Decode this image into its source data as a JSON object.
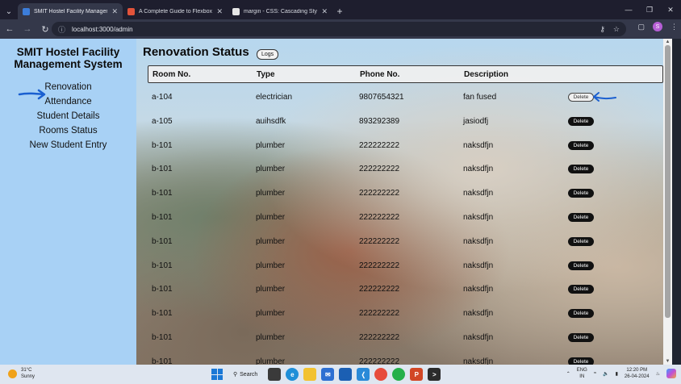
{
  "browser": {
    "tabs": [
      {
        "title": "SMIT Hostel Facility Manageme",
        "active": true,
        "favicon_color": "#3c7dd9"
      },
      {
        "title": "A Complete Guide to Flexbox |",
        "active": false,
        "favicon_color": "#e2533a"
      },
      {
        "title": "margin - CSS: Cascading Style S",
        "active": false,
        "favicon_color": "#e6e6e6"
      }
    ],
    "url": "localhost:3000/admin",
    "profile_initial": "S"
  },
  "sidebar": {
    "brand": "SMIT Hostel Facility Management System",
    "items": [
      {
        "label": "Renovation"
      },
      {
        "label": "Attendance"
      },
      {
        "label": "Student Details"
      },
      {
        "label": "Rooms Status"
      },
      {
        "label": "New Student Entry"
      }
    ]
  },
  "main": {
    "title": "Renovation Status",
    "logs_label": "Logs",
    "columns": [
      "Room No.",
      "Type",
      "Phone No.",
      "Description"
    ],
    "delete_label": "Delete",
    "rows": [
      {
        "room": "a-104",
        "type": "electrician",
        "phone": "9807654321",
        "desc": "fan fused"
      },
      {
        "room": "a-105",
        "type": "auihsdfk",
        "phone": "893292389",
        "desc": "jasiodfj"
      },
      {
        "room": "b-101",
        "type": "plumber",
        "phone": "222222222",
        "desc": "naksdfjn"
      },
      {
        "room": "b-101",
        "type": "plumber",
        "phone": "222222222",
        "desc": "naksdfjn"
      },
      {
        "room": "b-101",
        "type": "plumber",
        "phone": "222222222",
        "desc": "naksdfjn"
      },
      {
        "room": "b-101",
        "type": "plumber",
        "phone": "222222222",
        "desc": "naksdfjn"
      },
      {
        "room": "b-101",
        "type": "plumber",
        "phone": "222222222",
        "desc": "naksdfjn"
      },
      {
        "room": "b-101",
        "type": "plumber",
        "phone": "222222222",
        "desc": "naksdfjn"
      },
      {
        "room": "b-101",
        "type": "plumber",
        "phone": "222222222",
        "desc": "naksdfjn"
      },
      {
        "room": "b-101",
        "type": "plumber",
        "phone": "222222222",
        "desc": "naksdfjn"
      },
      {
        "room": "b-101",
        "type": "plumber",
        "phone": "222222222",
        "desc": "naksdfjn"
      },
      {
        "room": "b-101",
        "type": "plumber",
        "phone": "222222222",
        "desc": "naksdfjn"
      }
    ]
  },
  "taskbar": {
    "weather_temp": "31°C",
    "weather_desc": "Sunny",
    "search_label": "Search",
    "lang": "ENG",
    "lang_region": "IN",
    "time": "12:20 PM",
    "date": "26-04-2024"
  },
  "colors": {
    "sidebar_bg": "#a8d1f5",
    "annotation_arrow": "#1a5fd0"
  }
}
